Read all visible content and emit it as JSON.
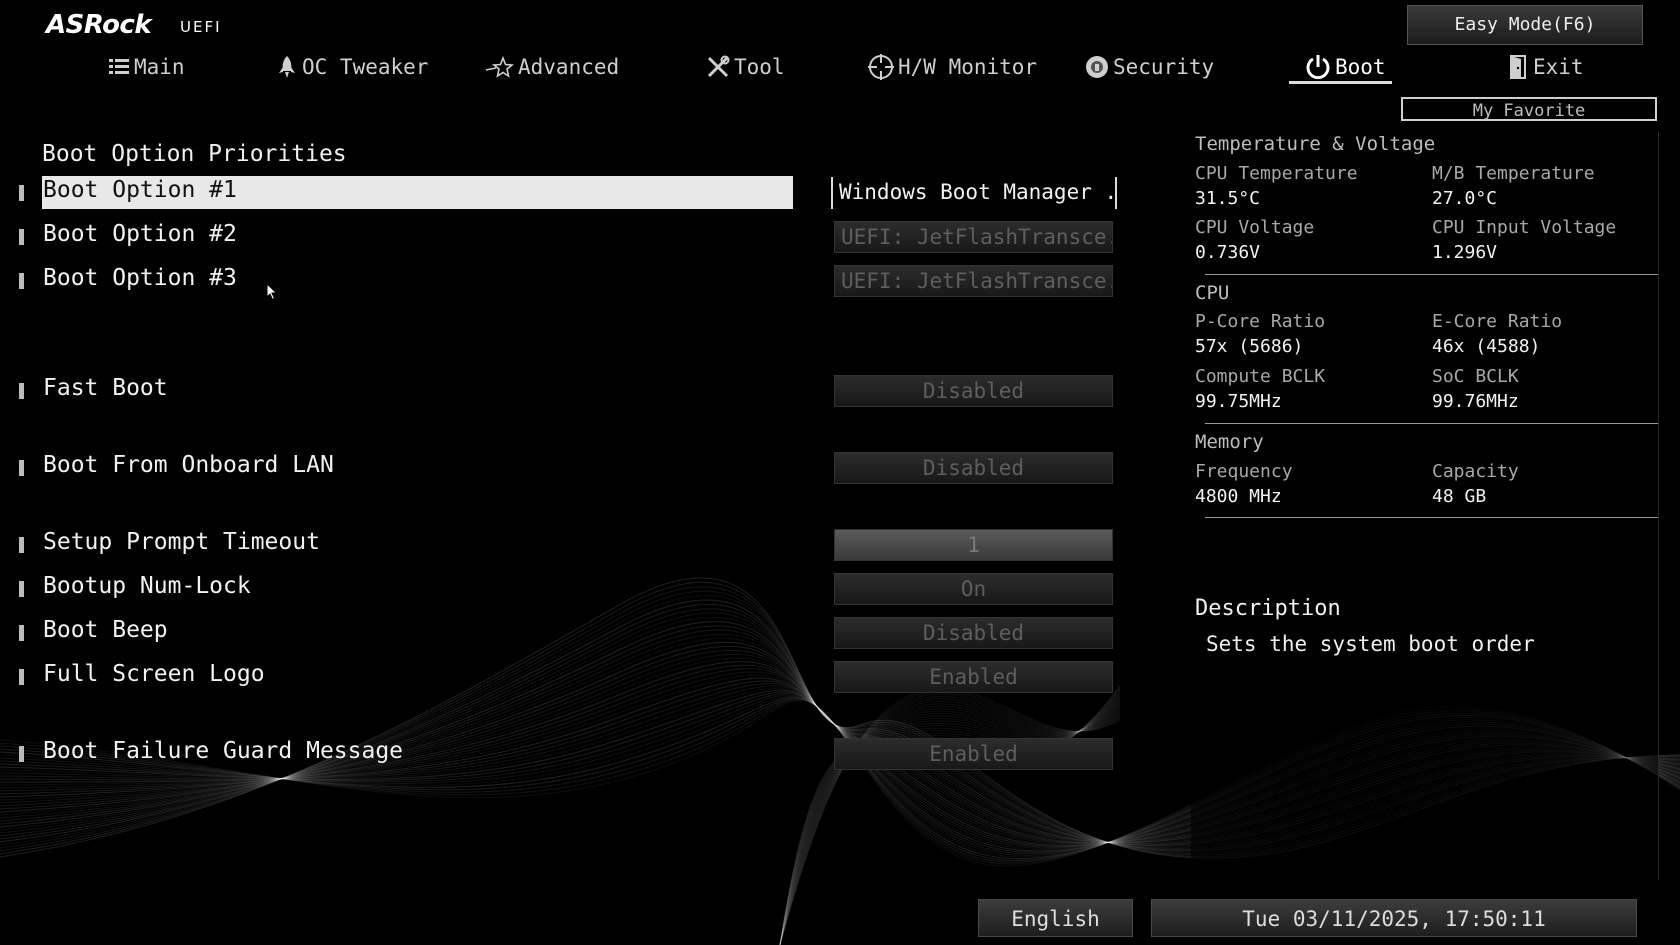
{
  "logo": {
    "brand": "ASRock",
    "sub": "UEFI"
  },
  "easy_mode_label": "Easy Mode(F6)",
  "my_favorite_label": "My Favorite",
  "tabs": [
    {
      "label": "Main",
      "icon": "list-icon"
    },
    {
      "label": "OC Tweaker",
      "icon": "rocket-icon"
    },
    {
      "label": "Advanced",
      "icon": "star-icon"
    },
    {
      "label": "Tool",
      "icon": "wrench-icon"
    },
    {
      "label": "H/W Monitor",
      "icon": "crosshair-icon"
    },
    {
      "label": "Security",
      "icon": "shield-icon"
    },
    {
      "label": "Boot",
      "icon": "power-icon",
      "active": true
    },
    {
      "label": "Exit",
      "icon": "door-icon"
    }
  ],
  "boot": {
    "section_title": "Boot Option Priorities",
    "rows": [
      {
        "label": "Boot Option #1",
        "value": "Windows Boot Manager ...",
        "selected": true
      },
      {
        "label": "Boot Option #2",
        "value": "UEFI: JetFlashTransce..."
      },
      {
        "label": "Boot Option #3",
        "value": "UEFI: JetFlashTransce..."
      },
      {
        "label": "Fast Boot",
        "value": "Disabled"
      },
      {
        "label": "Boot From Onboard LAN",
        "value": "Disabled"
      },
      {
        "label": "Setup Prompt Timeout",
        "value": "1"
      },
      {
        "label": "Bootup Num-Lock",
        "value": "On"
      },
      {
        "label": "Boot Beep",
        "value": "Disabled"
      },
      {
        "label": "Full Screen Logo",
        "value": "Enabled"
      },
      {
        "label": "Boot Failure Guard Message",
        "value": "Enabled"
      }
    ]
  },
  "monitor": {
    "tv_title": "Temperature & Voltage",
    "cpu_temp_label": "CPU Temperature",
    "cpu_temp": "31.5°C",
    "mb_temp_label": "M/B Temperature",
    "mb_temp": "27.0°C",
    "cpu_volt_label": "CPU Voltage",
    "cpu_volt": "0.736V",
    "cpu_in_volt_label": "CPU Input Voltage",
    "cpu_in_volt": "1.296V",
    "cpu_title": "CPU",
    "pcore_label": "P-Core Ratio",
    "pcore": "57x (5686)",
    "ecore_label": "E-Core Ratio",
    "ecore": "46x (4588)",
    "bclk_label": "Compute BCLK",
    "bclk": "99.75MHz",
    "soc_label": "SoC BCLK",
    "soc": "99.76MHz",
    "mem_title": "Memory",
    "freq_label": "Frequency",
    "freq": "4800 MHz",
    "cap_label": "Capacity",
    "cap": "48 GB"
  },
  "description": {
    "title": "Description",
    "text": "Sets the system boot order"
  },
  "footer": {
    "language": "English",
    "datetime": "Tue 03/11/2025, 17:50:11"
  }
}
